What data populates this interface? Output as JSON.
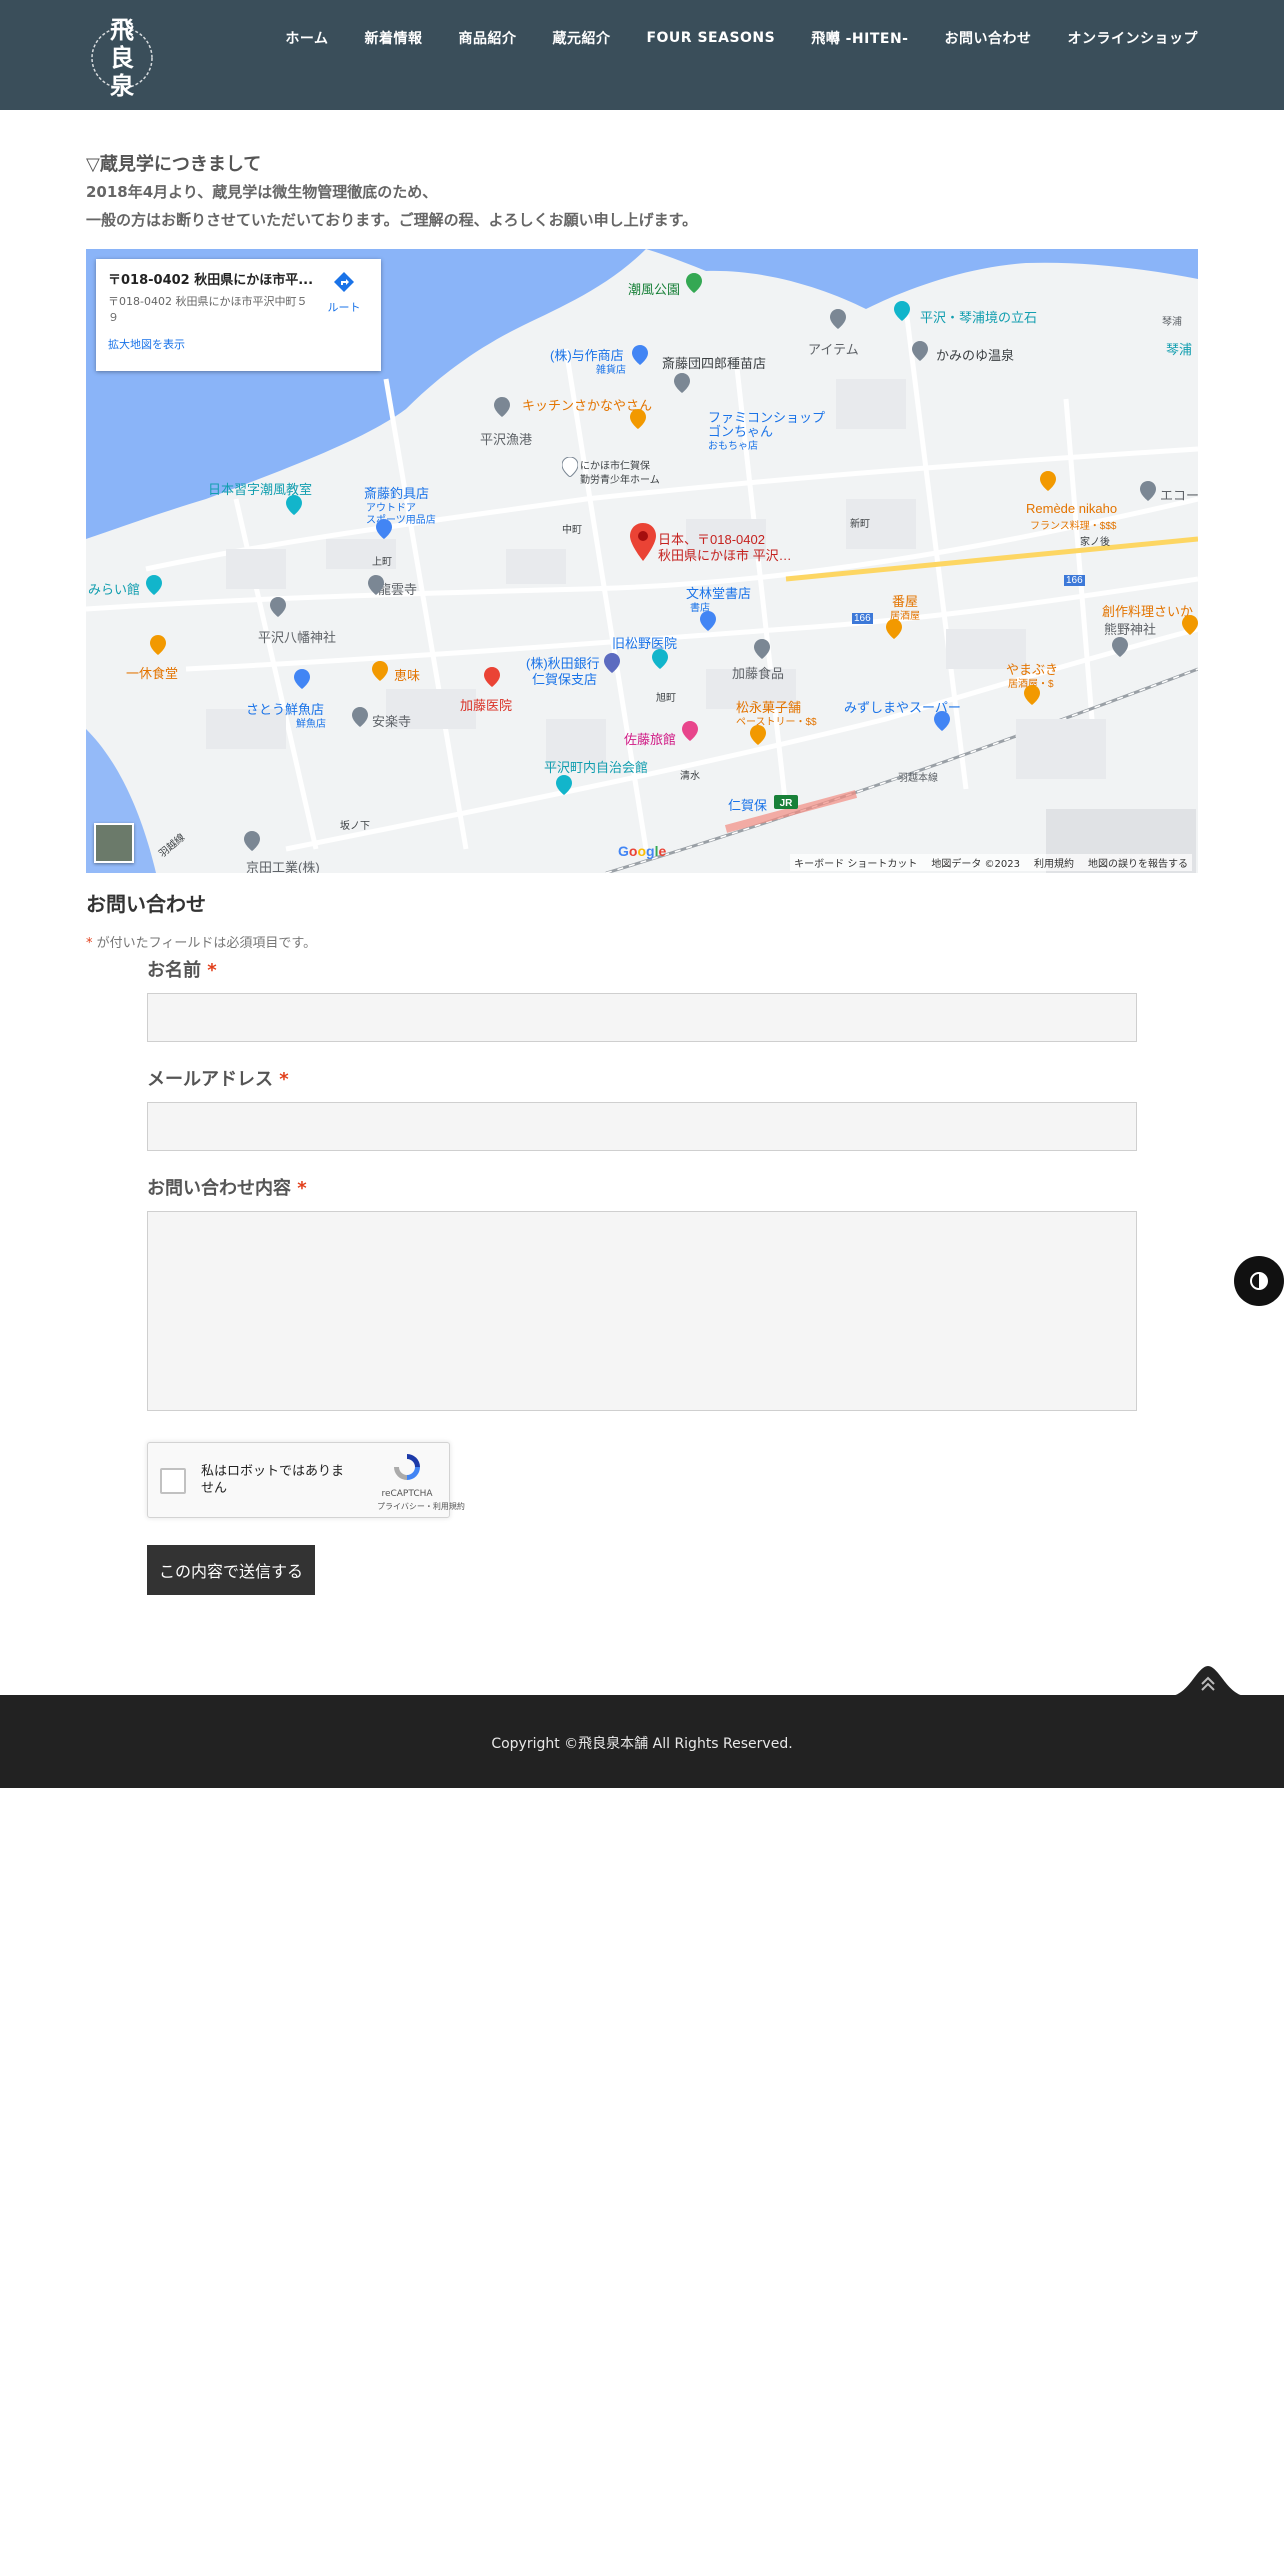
{
  "header": {
    "logo_text": "飛良泉",
    "nav": [
      "ホーム",
      "新着情報",
      "商品紹介",
      "蔵元紹介",
      "FOUR SEASONS",
      "飛囀 -HITEN-",
      "お問い合わせ",
      "オンラインショップ"
    ]
  },
  "intro": {
    "title": "▽蔵見学につきまして",
    "line1": "2018年4月より、蔵見学は微生物管理徹底のため、",
    "line2": "一般の方はお断りさせていただいております。ご理解の程、よろしくお願い申し上げます。"
  },
  "map": {
    "card_title": "〒018-0402 秋田県にかほ市平...",
    "card_address": "〒018-0402 秋田県にかほ市平沢中町５９",
    "card_link": "拡大地図を表示",
    "route_label": "ルート",
    "marker_line1": "日本、〒018-0402",
    "marker_line2": "秋田県にかほ市 平沢…",
    "google_logo": "Google",
    "footer_links": [
      "キーボード ショートカット",
      "地図データ ©2023",
      "利用規約",
      "地図の誤りを報告する"
    ],
    "places": {
      "p1": "潮風公園",
      "p2": "平沢・琴浦境の立石",
      "p3": "アイテム",
      "p4": "かみのゆ温泉",
      "p5": "(株)与作商店",
      "p5s": "雑貨店",
      "p6": "斎藤団四郎種苗店",
      "p7": "キッチンさかなやさん",
      "p8": "ファミコンショップ",
      "p8b": "ゴンちゃん",
      "p8s": "おもちゃ店",
      "p9": "平沢漁港",
      "p10": "にかほ市仁賀保",
      "p10b": "勤労青少年ホーム",
      "p11": "日本習字潮風教室",
      "p12": "斎藤釣具店",
      "p12s": "アウトドア",
      "p12t": "スポーツ用品店",
      "p13": "上町",
      "p14": "中町",
      "p15": "新町",
      "p16": "Remède nikaho",
      "p16s": "フランス料理・$$$",
      "p17": "家ノ後",
      "p18": "龍雲寺",
      "p19": "文林堂書店",
      "p19s": "書店",
      "p20": "みらい館",
      "p21": "平沢八幡神社",
      "p22": "番屋",
      "p22s": "居酒屋",
      "p23": "創作料理さいか",
      "p24": "熊野神社",
      "p25": "一休食堂",
      "p26": "旧松野医院",
      "p27": "加藤食品",
      "p28": "恵味",
      "p29": "(株)秋田銀行",
      "p29b": "仁賀保支店",
      "p30": "加藤医院",
      "p31": "旭町",
      "p32": "やまぶき",
      "p32s": "居酒屋・$",
      "p33": "さとう鮮魚店",
      "p33s": "鮮魚店",
      "p34": "安楽寺",
      "p35": "松永菓子舗",
      "p35s": "ペーストリー・$$",
      "p36": "みずしまやスーパー",
      "p37": "佐藤旅館",
      "p38": "清水",
      "p39": "平沢町内自治会館",
      "p40": "仁賀保",
      "p41": "羽越本線",
      "p42": "坂ノ下",
      "p43": "京田工業(株)",
      "p44": "琴浦",
      "p45": "エコー",
      "p46": "琴浦",
      "p47": "166",
      "p48": "166",
      "p49": "羽越線"
    }
  },
  "form": {
    "title": "お問い合わせ",
    "required_mark": "*",
    "required_note": " が付いたフィールドは必須項目です。",
    "name_label": "お名前",
    "email_label": "メールアドレス",
    "message_label": "お問い合わせ内容",
    "captcha_text": "私はロボットではありません",
    "captcha_brand": "reCAPTCHA",
    "captcha_links": "プライバシー・利用規約",
    "submit_label": "この内容で送信する"
  },
  "footer": {
    "copyright": "Copyright ©飛良泉本舗 All Rights Reserved."
  },
  "colors": {
    "header_bg": "#3a4e5a",
    "footer_bg": "#222222",
    "submit_bg": "#333333",
    "required": "#e2401c",
    "map_water": "#8ab4f8",
    "marker": "#ea4335"
  }
}
